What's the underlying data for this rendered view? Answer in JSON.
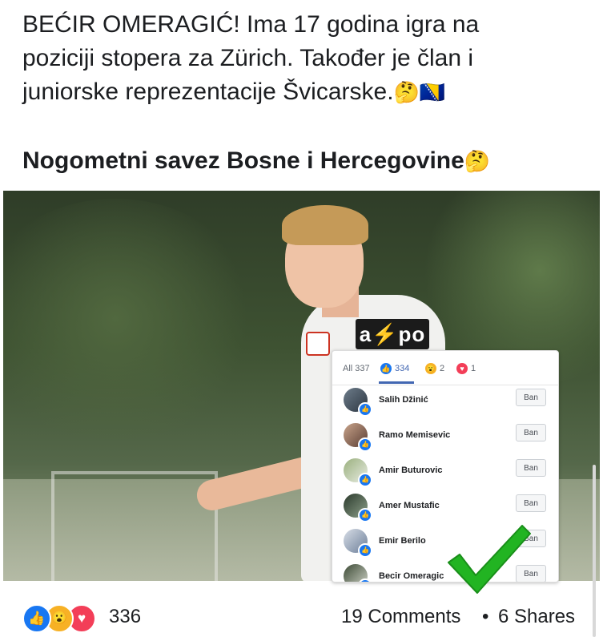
{
  "post": {
    "text_line1": "BEĆIR OMERAGIĆ! Ima 17 godina igra na",
    "text_line2": "poziciji stopera za Zürich. Također je član i",
    "text_line3": "juniorske reprezentacije Švicarske.",
    "emoji_thinking": "🤔",
    "emoji_flag": "🇧🇦",
    "page_name": "Nogometni savez Bosne i Hercegovine",
    "photo_sponsor": "a⚡po"
  },
  "reactions_panel": {
    "tab_all": "All 337",
    "tab_like_count": "334",
    "tab_wow_count": "2",
    "tab_love_count": "1",
    "ban_label": "Ban",
    "users": [
      {
        "name": "Salih Džinić"
      },
      {
        "name": "Ramo Memisevic"
      },
      {
        "name": "Amir Buturovic"
      },
      {
        "name": "Amer Mustafic"
      },
      {
        "name": "Emir Berilo"
      },
      {
        "name": "Becir Omeragic"
      }
    ]
  },
  "footer": {
    "reaction_count": "336",
    "comments": "19 Comments",
    "separator": "•",
    "shares": "6 Shares"
  },
  "colors": {
    "like_blue": "#1877f2",
    "wow_yellow": "#f7b125",
    "love_red": "#f33e58",
    "check_green": "#22b422"
  }
}
